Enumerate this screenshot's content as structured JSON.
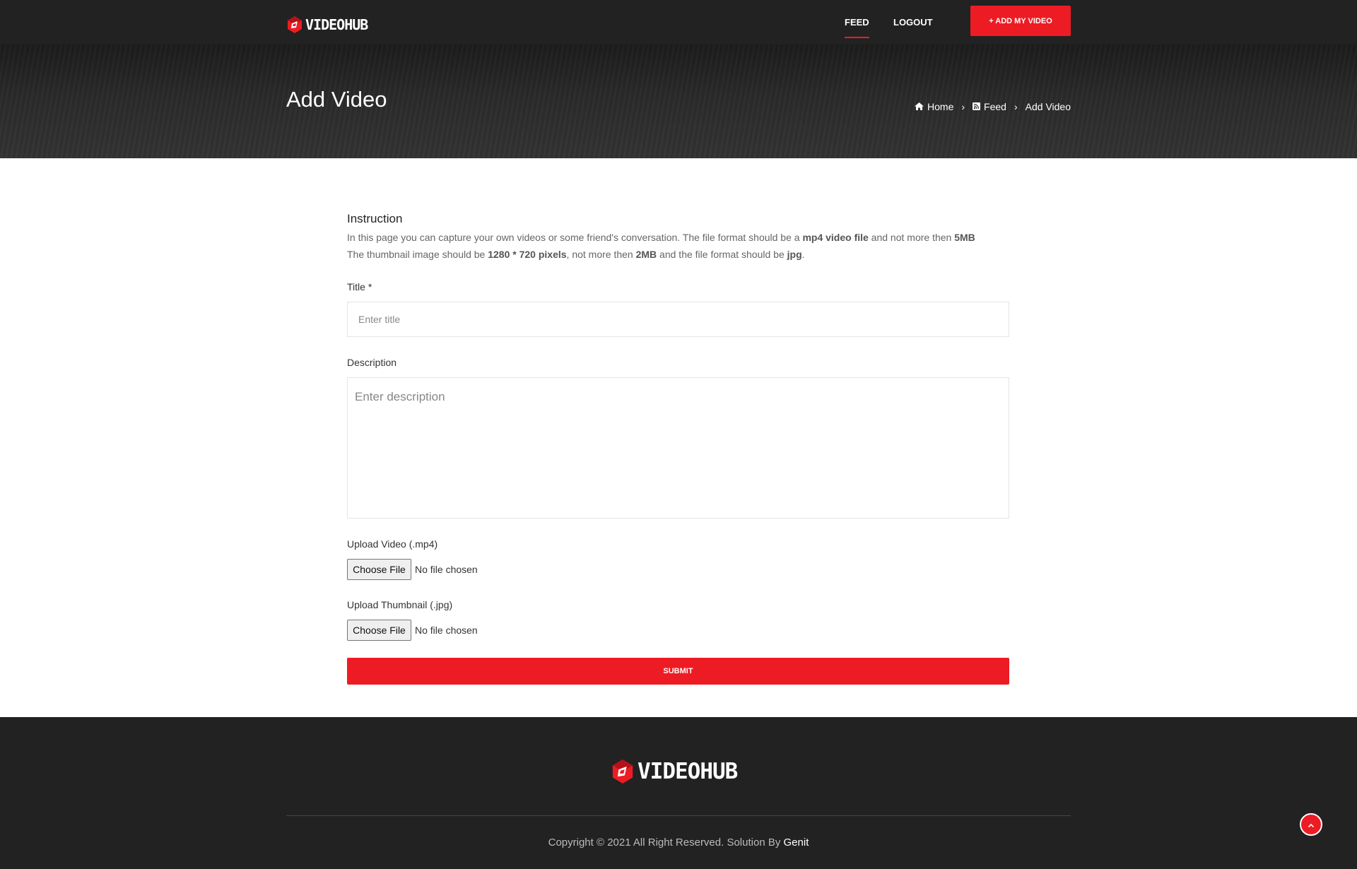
{
  "header": {
    "logo_text": "VIDEOHUB",
    "nav": {
      "feed": "FEED",
      "logout": "LOGOUT"
    },
    "add_button": "+ ADD MY VIDEO"
  },
  "hero": {
    "title": "Add Video",
    "breadcrumb": {
      "home": "Home",
      "feed": "Feed",
      "current": "Add Video",
      "separator": "›"
    }
  },
  "instructions": {
    "heading": "Instruction",
    "line1_a": "In this page you can capture your own videos or some friend's conversation. The file format should be a ",
    "line1_b": "mp4 video file",
    "line1_c": " and not more then ",
    "line1_d": "5MB",
    "line2_a": "The thumbnail image should be ",
    "line2_b": "1280 * 720 pixels",
    "line2_c": ", not more then ",
    "line2_d": "2MB",
    "line2_e": " and the file format should be ",
    "line2_f": "jpg",
    "line2_g": "."
  },
  "form": {
    "title_label": "Title *",
    "title_placeholder": "Enter title",
    "description_label": "Description",
    "description_placeholder": "Enter description",
    "video_label": "Upload Video (.mp4)",
    "thumbnail_label": "Upload Thumbnail (.jpg)",
    "choose_file": "Choose File",
    "no_file": "No file chosen",
    "submit": "SUBMIT"
  },
  "footer": {
    "logo_text": "VIDEOHUB",
    "copyright": "Copyright © 2021 All Right Reserved. Solution By ",
    "credit": "Genit"
  },
  "colors": {
    "accent": "#ed1c24",
    "dark": "#222222"
  }
}
